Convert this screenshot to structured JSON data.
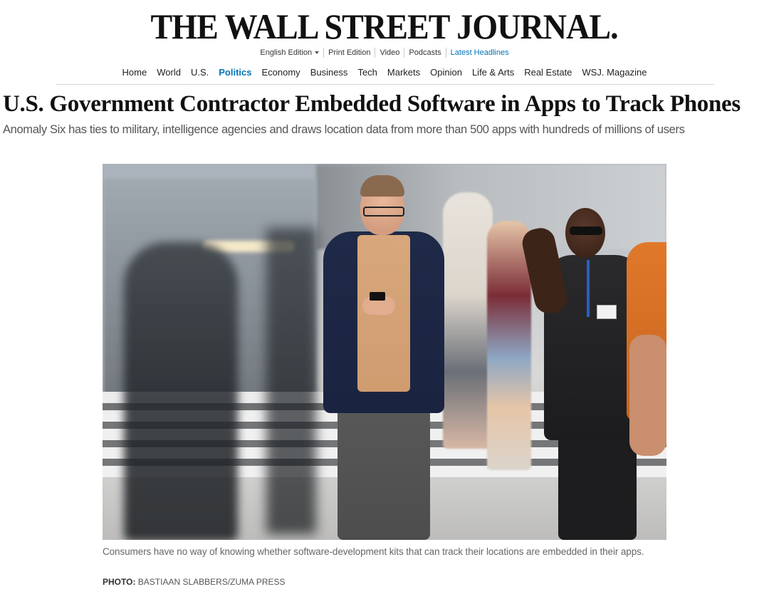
{
  "masthead": {
    "logo_text": "THE WALL STREET JOURNAL."
  },
  "edition_bar": {
    "items": [
      {
        "label": "English Edition",
        "has_dropdown": true
      },
      {
        "label": "Print Edition"
      },
      {
        "label": "Video"
      },
      {
        "label": "Podcasts"
      },
      {
        "label": "Latest Headlines",
        "highlight": true
      }
    ],
    "latest_color": "#0274b6"
  },
  "nav": {
    "items": [
      {
        "label": "Home"
      },
      {
        "label": "World"
      },
      {
        "label": "U.S."
      },
      {
        "label": "Politics",
        "active": true
      },
      {
        "label": "Economy"
      },
      {
        "label": "Business"
      },
      {
        "label": "Tech"
      },
      {
        "label": "Markets"
      },
      {
        "label": "Opinion"
      },
      {
        "label": "Life & Arts"
      },
      {
        "label": "Real Estate"
      },
      {
        "label": "WSJ. Magazine"
      }
    ],
    "active_color": "#0274b6"
  },
  "article": {
    "headline": "U.S. Government Contractor Embedded Software in Apps to Track Phones",
    "dek": "Anomaly Six has ties to military, intelligence agencies and draws location data from more than 500 apps with hundreds of millions of users",
    "image": {
      "caption": "Consumers have no way of knowing whether software-development kits that can track their locations are embedded in their apps.",
      "credit_label": "PHOTO:",
      "credit_value": "BASTIAAN SLABBERS/ZUMA PRESS"
    }
  }
}
